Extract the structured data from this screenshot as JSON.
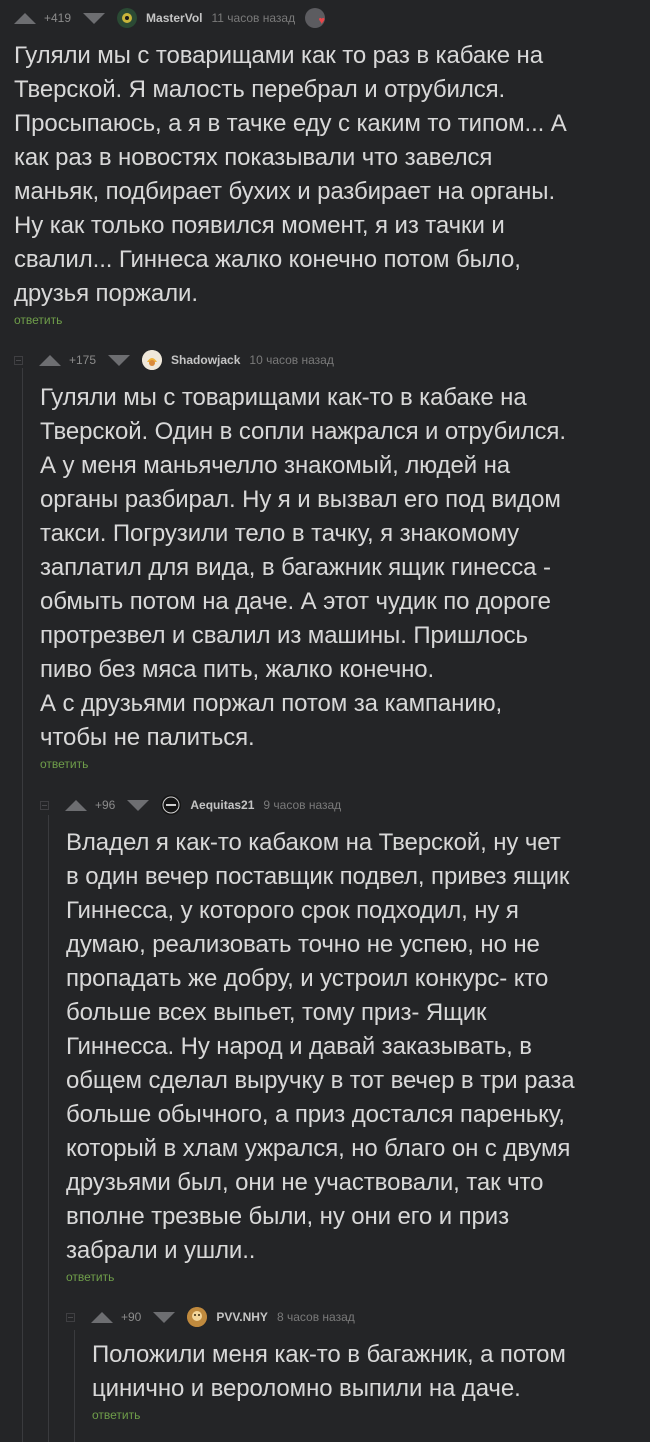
{
  "comments": [
    {
      "rating": "+419",
      "username": "MasterVol",
      "time": "11 часов назад",
      "lines": [
        "Гуляли мы с товарищами как то раз в кабаке на",
        "Тверской. Я малость перебрал и отрубился.",
        "Просыпаюсь, а я в тачке еду с каким то типом... А",
        "как раз в новостях показывали что завелся",
        "маньяк, подбирает бухих и разбирает на органы.",
        "Ну как только появился момент, я из тачки и",
        "свалил... Гиннеса жалко конечно потом было,",
        "друзья поржали."
      ],
      "reply": "ответить"
    },
    {
      "rating": "+175",
      "username": "Shadowjack",
      "time": "10 часов назад",
      "lines": [
        "Гуляли мы с товарищами как-то в кабаке на",
        "Тверской. Один в сопли нажрался и отрубился.",
        "А у меня маньячелло знакомый, людей на",
        "органы разбирал. Ну я и вызвал его под видом",
        "такси. Погрузили тело в тачку, я знакомому",
        "заплатил для вида, в багажник ящик гинесса -",
        "обмыть потом на даче. А этот чудик по дороге",
        "протрезвел и свалил из машины. Пришлось",
        "пиво без мяса пить, жалко конечно.",
        "А с друзьями поржал потом за кампанию,",
        "чтобы не палиться."
      ],
      "reply": "ответить"
    },
    {
      "rating": "+96",
      "username": "Aequitas21",
      "time": "9 часов назад",
      "lines": [
        "Владел я как-то кабаком на Тверской, ну чет",
        "в один вечер поставщик подвел, привез ящик",
        "Гиннесса, у которого срок подходил, ну я",
        "думаю, реализовать точно не успею, но не",
        "пропадать же добру, и устроил конкурс- кто",
        "больше всех выпьет, тому приз- Ящик",
        "Гиннесса. Ну народ и давай заказывать, в",
        "общем сделал выручку в тот вечер в три раза",
        "больше обычного, а приз достался пареньку,",
        "который в хлам ужрался, но благо он с двумя",
        "друзьями был, они не участвовали, так что",
        "вполне трезвые были, ну они его и приз",
        "забрали и ушли.."
      ],
      "reply": "ответить"
    },
    {
      "rating": "+90",
      "username": "PVV.NHY",
      "time": "8 часов назад",
      "lines": [
        "Положили меня как-то в багажник, а потом",
        "цинично и вероломно выпили на даче."
      ],
      "reply": "ответить"
    }
  ],
  "icons": {
    "vote_up": "triangle-up",
    "vote_down": "triangle-down",
    "collapse": "collapse-box",
    "badge": "heart-badge"
  },
  "colors": {
    "background": "#242527",
    "text": "#d8d8d8",
    "reply_link": "#6f9e4a",
    "meta": "#8b8b8b",
    "thread_line": "#3a3b3e"
  }
}
